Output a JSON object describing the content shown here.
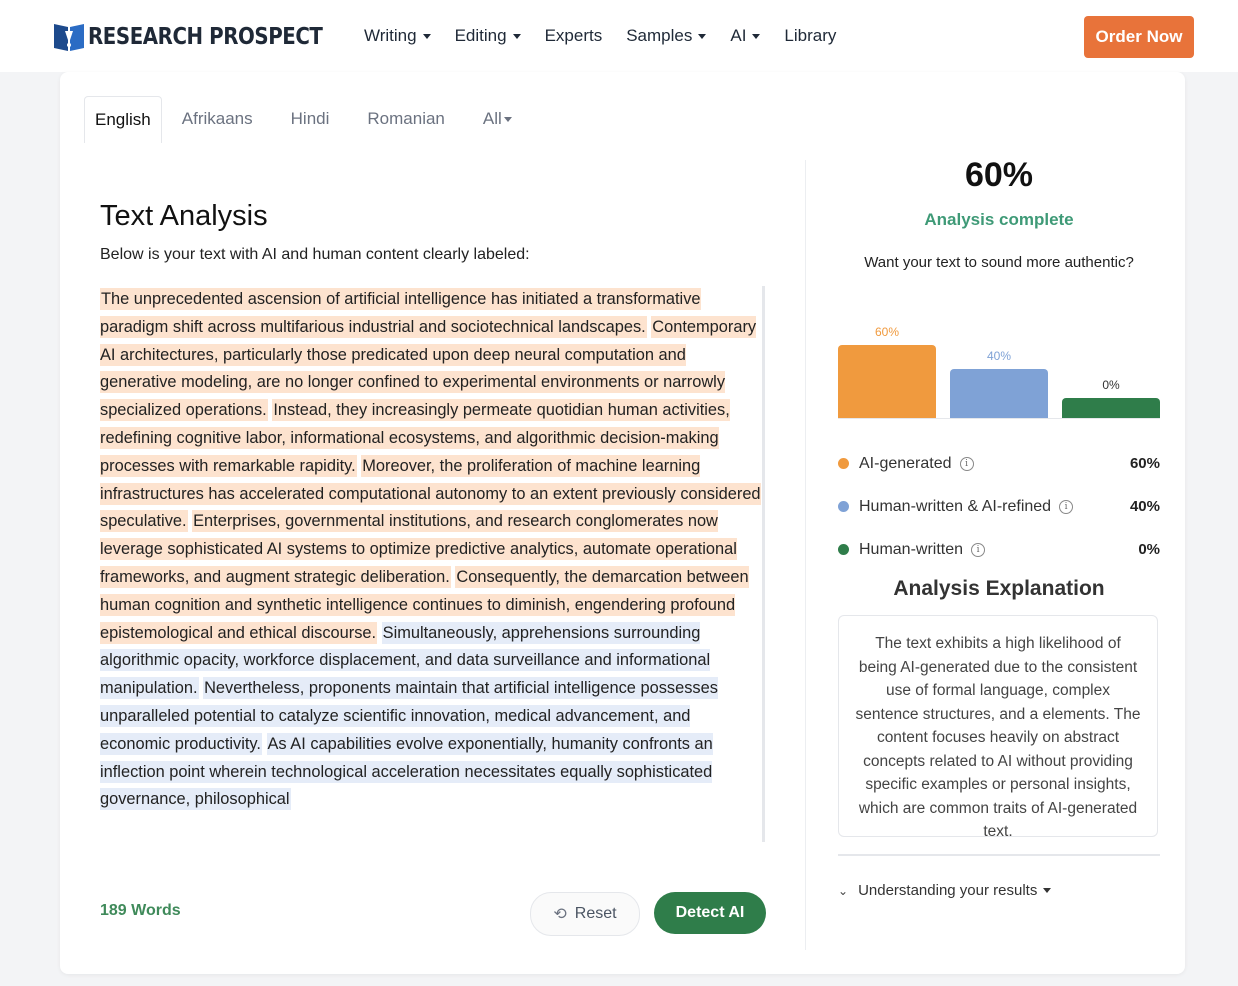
{
  "header": {
    "logo_text": "RESEARCH PROSPECT",
    "nav": [
      {
        "label": "Writing",
        "dropdown": true
      },
      {
        "label": "Editing",
        "dropdown": true
      },
      {
        "label": "Experts",
        "dropdown": false
      },
      {
        "label": "Samples",
        "dropdown": true
      },
      {
        "label": "AI",
        "dropdown": true
      },
      {
        "label": "Library",
        "dropdown": false
      }
    ],
    "order_label": "Order Now",
    "order_color": "#e8733a"
  },
  "tabs": [
    {
      "label": "English",
      "active": true
    },
    {
      "label": "Afrikaans",
      "active": false
    },
    {
      "label": "Hindi",
      "active": false
    },
    {
      "label": "Romanian",
      "active": false
    },
    {
      "label": "All",
      "active": false,
      "dropdown": true
    }
  ],
  "analysis": {
    "title": "Text Analysis",
    "subtitle": "Below is your text with AI and human content clearly labeled:",
    "segments": [
      {
        "text": "The unprecedented ascension of artificial intelligence has initiated a transformative paradigm shift across multifarious industrial and sociotechnical landscapes.",
        "type": "ai"
      },
      {
        "text": "Contemporary AI architectures, particularly those predicated upon deep neural computation and generative modeling, are no longer confined to experimental environments or narrowly specialized operations.",
        "type": "ai"
      },
      {
        "text": "Instead, they increasingly permeate quotidian human activities, redefining cognitive labor, informational ecosystems, and algorithmic decision-making processes with remarkable rapidity.",
        "type": "ai"
      },
      {
        "text": "Moreover, the proliferation of machine learning infrastructures has accelerated computational autonomy to an extent previously considered speculative.",
        "type": "ai"
      },
      {
        "text": "Enterprises, governmental institutions, and research conglomerates now leverage sophisticated AI systems to optimize predictive analytics, automate operational frameworks, and augment strategic deliberation.",
        "type": "ai"
      },
      {
        "text": "Consequently, the demarcation between human cognition and synthetic intelligence continues to diminish, engendering profound epistemological and ethical discourse.",
        "type": "ai"
      },
      {
        "text": "Simultaneously, apprehensions surrounding algorithmic opacity, workforce displacement, and data surveillance and informational manipulation.",
        "type": "mix"
      },
      {
        "text": "Nevertheless, proponents maintain that artificial intelligence possesses unparalleled potential to catalyze scientific innovation, medical advancement, and economic productivity.",
        "type": "mix"
      },
      {
        "text": "As AI capabilities evolve exponentially, humanity confronts an inflection point wherein technological acceleration necessitates equally sophisticated governance, philosophical",
        "type": "mix"
      }
    ],
    "word_count": "189 Words",
    "reset_label": "Reset",
    "detect_label": "Detect AI"
  },
  "result": {
    "score": "60%",
    "status": "Analysis complete",
    "prompt": "Want your text to sound more authentic?",
    "legend": [
      {
        "label": "AI-generated",
        "value": "60%",
        "color": "#f09a3e"
      },
      {
        "label": "Human-written & AI-refined",
        "value": "40%",
        "color": "#7fa2d6"
      },
      {
        "label": "Human-written",
        "value": "0%",
        "color": "#2f7d4a"
      }
    ],
    "explanation_title": "Analysis Explanation",
    "explanation": "The text exhibits a high likelihood of being AI-generated due to the consistent use of formal language, complex sentence structures, and a elements. The content focuses heavily on abstract concepts related to AI without providing specific examples or personal insights, which are common traits of AI-generated text.",
    "understanding_label": "Understanding your results"
  },
  "chart_data": {
    "type": "bar",
    "categories": [
      "AI-generated",
      "Human-written & AI-refined",
      "Human-written"
    ],
    "values": [
      60,
      40,
      0
    ],
    "value_labels": [
      "60%",
      "40%",
      "0%"
    ],
    "colors": [
      "#f09a3e",
      "#7fa2d6",
      "#2f7d4a"
    ],
    "ylim": [
      0,
      60
    ]
  }
}
